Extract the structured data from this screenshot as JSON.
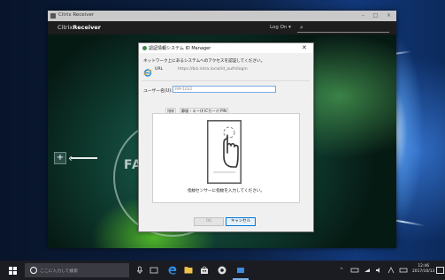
{
  "citrix": {
    "title": "Citrix Receiver",
    "brand_prefix": "Citrix",
    "brand_bold": "Receiver",
    "logon": "Log On ▾",
    "search_icon": "magnifier-icon",
    "min": "–",
    "max": "□",
    "close": "×",
    "plus": "+",
    "fav_text": "FAV"
  },
  "dialog": {
    "title": "認証情報システム  ID Manager",
    "close": "✕",
    "message": "ネットワーク上にあるシステムへのアクセスを認証してください。",
    "url_label": "URL",
    "url_value": "https://biz.intra.local/id_auth/login",
    "user_label": "ユーザー名(U):",
    "user_value": "RM-1032",
    "tabs": [
      "指紋",
      "静脈・キー(K)",
      "ICカード",
      "PIN"
    ],
    "hint": "指紋センサーに指紋を入力してください。",
    "ok": "OK",
    "cancel": "キャンセル"
  },
  "taskbar": {
    "search_placeholder": "ここに入力して検索",
    "tray_chevron": "^",
    "clock_time": "12:46",
    "clock_date": "2017/10/13"
  },
  "colors": {
    "dialog_accent": "#0078d7",
    "taskbar": "#1b1c22",
    "citrix_bar": "#1d1d1d"
  }
}
